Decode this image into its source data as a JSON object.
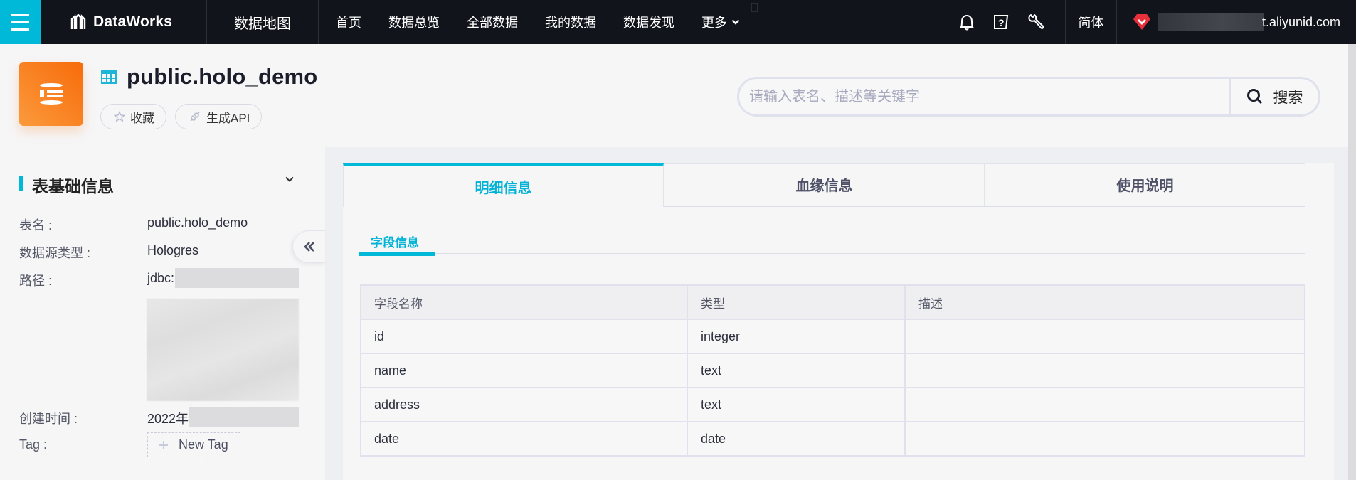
{
  "topbar": {
    "menu_icon": "hamburger-icon",
    "brand": "DataWorks",
    "module": "数据地图",
    "nav": [
      "首页",
      "数据总览",
      "全部数据",
      "我的数据",
      "数据发现"
    ],
    "more": "更多",
    "icons": [
      "bell-icon",
      "help-icon",
      "wrench-icon"
    ],
    "language": "简体",
    "user_domain": "t.aliyunid.com"
  },
  "header": {
    "title": "public.holo_demo",
    "favorite_label": "收藏",
    "generate_api_label": "生成API",
    "search_placeholder": "请输入表名、描述等关键字",
    "search_button": "搜索"
  },
  "sidebar": {
    "title": "表基础信息",
    "fields": [
      {
        "label": "表名 :",
        "value": "public.holo_demo"
      },
      {
        "label": "数据源类型 :",
        "value": "Hologres"
      },
      {
        "label": "路径 :",
        "value": "jdbc:"
      },
      {
        "label": "创建时间 :",
        "value": "2022年"
      },
      {
        "label": "Tag :",
        "value": ""
      }
    ],
    "new_tag": "New Tag"
  },
  "main": {
    "tabs": [
      {
        "label": "明细信息",
        "active": true
      },
      {
        "label": "血缘信息",
        "active": false
      },
      {
        "label": "使用说明",
        "active": false
      }
    ],
    "subtab": "字段信息",
    "table": {
      "columns": [
        "字段名称",
        "类型",
        "描述"
      ],
      "rows": [
        [
          "id",
          "integer",
          ""
        ],
        [
          "name",
          "text",
          ""
        ],
        [
          "address",
          "text",
          ""
        ],
        [
          "date",
          "date",
          ""
        ]
      ]
    }
  },
  "colors": {
    "accent": "#00b9d8",
    "topbar_bg": "#12141c",
    "logo_orange": "#f7801f",
    "heart_red": "#e8303a"
  }
}
